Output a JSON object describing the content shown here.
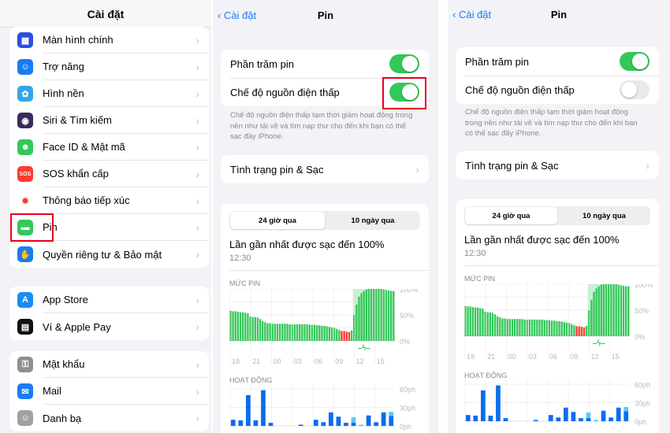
{
  "left": {
    "title": "Cài đặt",
    "groups": [
      [
        {
          "label": "Màn hình chính",
          "icon": "home-screen-icon",
          "color": "#2b4fe0",
          "g": "▦"
        },
        {
          "label": "Trợ năng",
          "icon": "accessibility-icon",
          "color": "#1a7cf5",
          "g": "☺"
        },
        {
          "label": "Hình nền",
          "icon": "wallpaper-icon",
          "color": "#36a4e6",
          "g": "✿"
        },
        {
          "label": "Siri & Tìm kiếm",
          "icon": "siri-icon",
          "color": "#3a2a5a",
          "g": "◉"
        },
        {
          "label": "Face ID & Mật mã",
          "icon": "face-id-icon",
          "color": "#34c759",
          "g": "☻"
        },
        {
          "label": "SOS khẩn cấp",
          "icon": "sos-icon",
          "color": "#ff3b30",
          "g": "SOS"
        },
        {
          "label": "Thông báo tiếp xúc",
          "icon": "exposure-notification-icon",
          "color": "#ffffff",
          "g": "✹"
        },
        {
          "label": "Pin",
          "icon": "battery-icon",
          "color": "#34c759",
          "g": "▬"
        },
        {
          "label": "Quyền riêng tư & Bảo mật",
          "icon": "privacy-hand-icon",
          "color": "#1a7cf5",
          "g": "✋"
        }
      ],
      [
        {
          "label": "App Store",
          "icon": "app-store-icon",
          "color": "#1a8cf5",
          "g": "A"
        },
        {
          "label": "Ví & Apple Pay",
          "icon": "wallet-icon",
          "color": "#111111",
          "g": "▤"
        }
      ],
      [
        {
          "label": "Mật khẩu",
          "icon": "key-icon",
          "color": "#8e8e93",
          "g": "⚿"
        },
        {
          "label": "Mail",
          "icon": "mail-icon",
          "color": "#1a7cf5",
          "g": "✉"
        },
        {
          "label": "Danh bạ",
          "icon": "contacts-icon",
          "color": "#a0a0a5",
          "g": "☺"
        }
      ]
    ]
  },
  "battery": {
    "back": "Cài đặt",
    "title": "Pin",
    "percent_label": "Phần trăm pin",
    "low_power_label": "Chế độ nguồn điện thấp",
    "footer": "Chế độ nguồn điện thấp tạm thời giảm hoạt động trong nền như tải về và tìm nạp thư cho đến khi bạn có thể sạc đầy iPhone.",
    "health_label": "Tình trạng pin & Sạc",
    "seg_24h": "24 giờ qua",
    "seg_10d": "10 ngày qua",
    "last_charged": "Lần gần nhất được sạc đến 100%",
    "last_time": "12:30",
    "level_caption": "MỨC PIN",
    "activity_caption": "HOẠT ĐỘNG"
  },
  "screens": [
    {
      "percent_on": true,
      "low_power_on": true
    },
    {
      "percent_on": true,
      "low_power_on": false
    }
  ],
  "colors": {
    "green": "#34c759",
    "red": "#ff3b30",
    "blue": "#0a6cf0",
    "lightblue": "#5ac8fa",
    "highlight": "#e8001c"
  },
  "chart_data": [
    {
      "type": "bar",
      "name": "battery-level",
      "x_ticks": [
        "18",
        "21",
        "00",
        "03",
        "06",
        "09",
        "12",
        "15"
      ],
      "y_ticks": [
        "100%",
        "50%",
        "0%"
      ],
      "ylim": [
        0,
        100
      ],
      "values": [
        58,
        57,
        57,
        56,
        55,
        55,
        54,
        53,
        47,
        46,
        46,
        45,
        42,
        38,
        36,
        34,
        34,
        33,
        33,
        33,
        33,
        33,
        33,
        33,
        32,
        32,
        32,
        32,
        32,
        32,
        32,
        32,
        31,
        31,
        31,
        30,
        30,
        29,
        29,
        28,
        27,
        26,
        25,
        23,
        21,
        19,
        19,
        18,
        17,
        20,
        50,
        70,
        85,
        92,
        96,
        99,
        100,
        100,
        100,
        100,
        100,
        100,
        99,
        98,
        97,
        96,
        96
      ],
      "low_threshold": 20,
      "charging_from_index": 50,
      "charging_to_index": 57
    },
    {
      "type": "bar",
      "name": "activity",
      "y_ticks": [
        "60ph",
        "30ph",
        "0ph"
      ],
      "ylim": [
        0,
        60
      ],
      "unit": "ph",
      "screen_on": [
        10,
        9,
        50,
        9,
        58,
        5,
        0,
        0,
        0,
        2,
        0,
        10,
        6,
        22,
        15,
        5,
        5,
        0,
        17,
        6,
        22,
        16
      ],
      "screen_off": [
        0,
        0,
        0,
        0,
        0,
        0,
        0,
        0,
        0,
        0,
        0,
        0,
        0,
        0,
        0,
        0,
        9,
        2,
        0,
        0,
        0,
        7
      ]
    }
  ]
}
